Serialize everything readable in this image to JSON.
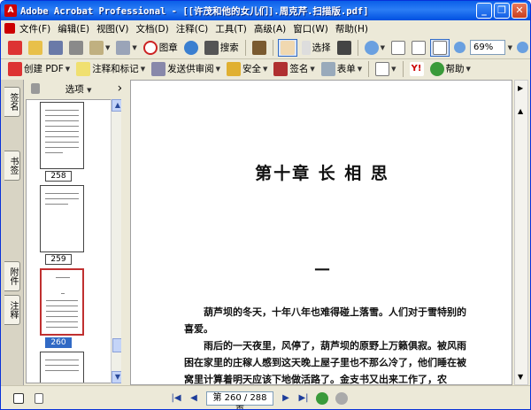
{
  "window": {
    "title": "Adobe Acrobat Professional - [[许茂和他的女儿们].周克芹.扫描版.pdf]",
    "app_icon": "A"
  },
  "menu": [
    {
      "label": "文件(F)"
    },
    {
      "label": "编辑(E)"
    },
    {
      "label": "视图(V)"
    },
    {
      "label": "文档(D)"
    },
    {
      "label": "注释(C)"
    },
    {
      "label": "工具(T)"
    },
    {
      "label": "高级(A)"
    },
    {
      "label": "窗口(W)"
    },
    {
      "label": "帮助(H)"
    }
  ],
  "toolbar1": {
    "stamp_label": "图章",
    "search_label": "搜索",
    "select_label": "选择",
    "zoom_value": "69%"
  },
  "toolbar2": {
    "create_pdf": "创建 PDF",
    "comment": "注释和标记",
    "send_review": "发送供审阅",
    "secure": "安全",
    "sign": "签名",
    "forms": "表单",
    "help": "帮助"
  },
  "leftpane": {
    "options_label": "选项",
    "close_glyph": "×",
    "tabs": [
      "签名",
      "书签",
      "附件",
      "注释"
    ]
  },
  "thumbnails": [
    {
      "label": "258",
      "selected": false
    },
    {
      "label": "259",
      "selected": false
    },
    {
      "label": "260",
      "selected": true
    }
  ],
  "doc": {
    "chapter_title": "第十章  长 相 思",
    "section_mark": "一",
    "paragraphs": [
      "葫芦坝的冬天，十年八年也难得碰上落雪。人们对于雪特别的喜爱。",
      "雨后的一天夜里，风停了，葫芦坝的原野上万籁俱寂。被风雨困在家里的庄稼人感到这天晚上屋子里也不那么冷了，他们睡在被窝里计算着明天应该下地做活路了。金支书又出来工作了，农"
    ]
  },
  "status": {
    "page_text": "第 260 / 288 页"
  },
  "colors": {
    "title_blue": "#0a5fe8",
    "accent": "#316ac5",
    "selected_border": "#c03030"
  }
}
